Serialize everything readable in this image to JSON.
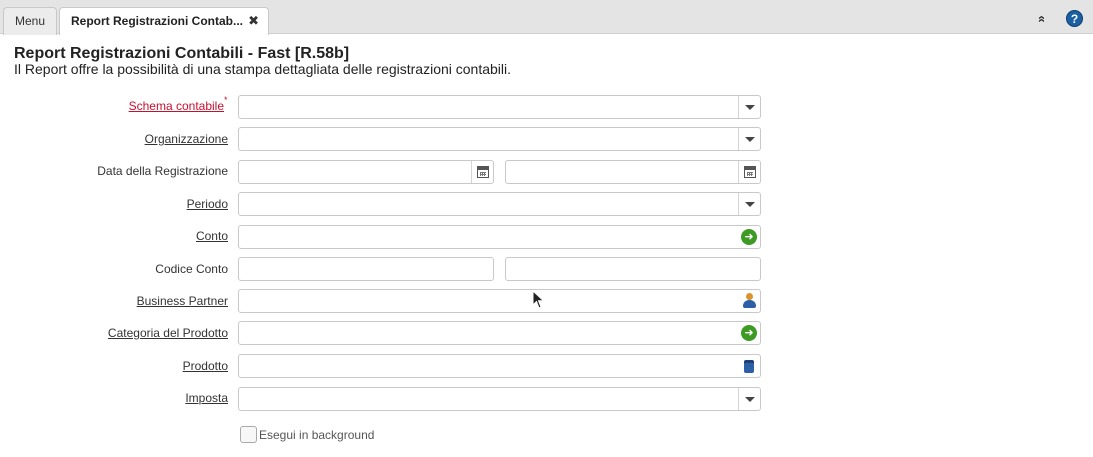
{
  "tabs": {
    "menu_label": "Menu",
    "active_label": "Report Registrazioni Contab...",
    "close_symbol": "✖"
  },
  "toolbar": {
    "collapse_symbol": "»",
    "help_symbol": "?"
  },
  "header": {
    "title": "Report Registrazioni Contabili - Fast [R.58b]",
    "description": "Il Report offre la possibilità di una stampa dettagliata delle registrazioni contabili."
  },
  "form": {
    "schema_contabile": {
      "label": "Schema contabile",
      "value": "",
      "required_mark": "*"
    },
    "organizzazione": {
      "label": "Organizzazione",
      "value": ""
    },
    "data_registrazione": {
      "label": "Data della Registrazione",
      "from": "",
      "to": ""
    },
    "periodo": {
      "label": "Periodo",
      "value": ""
    },
    "conto": {
      "label": "Conto",
      "value": ""
    },
    "codice_conto": {
      "label": "Codice Conto",
      "from": "",
      "to": ""
    },
    "business_partner": {
      "label": "Business Partner",
      "value": ""
    },
    "categoria_prodotto": {
      "label": "Categoria del Prodotto",
      "value": ""
    },
    "prodotto": {
      "label": "Prodotto",
      "value": ""
    },
    "imposta": {
      "label": "Imposta",
      "value": ""
    },
    "background": {
      "label": "Esegui in background",
      "checked": false
    }
  },
  "colors": {
    "mandatory_label": "#c8102e",
    "help_button": "#1b5fa3",
    "search_arrow": "#3d9a23"
  }
}
